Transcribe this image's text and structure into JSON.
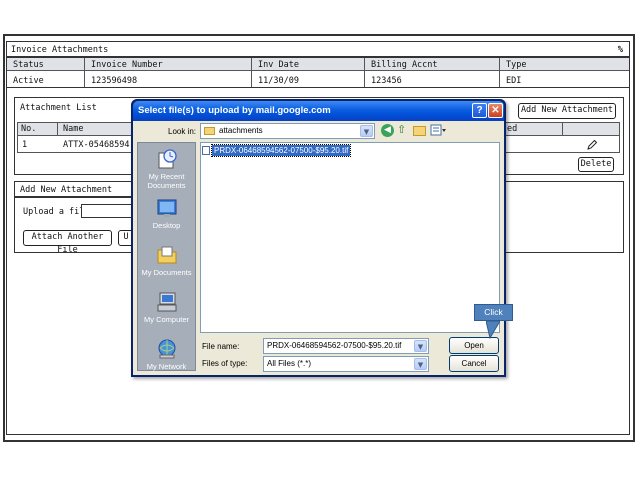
{
  "mockup": {
    "title": "Invoice Attachments",
    "title_badge": "%",
    "summary_headers": [
      "Status",
      "Invoice Number",
      "Inv Date",
      "Billing Accnt",
      "Type"
    ],
    "summary_values": [
      "Active",
      "123596498",
      "11/30/09",
      "123456",
      "EDI"
    ],
    "attachment_list": {
      "label": "Attachment List",
      "add_button": "Add New Attachment",
      "columns": [
        "No.",
        "Name",
        "ed"
      ],
      "rows": [
        {
          "no": "1",
          "name": "ATTX-05468594"
        }
      ],
      "delete_button": "Delete"
    },
    "add_new": {
      "label": "Add New Attachment",
      "upload_label": "Upload a file:",
      "attach_another_button": "Attach Another File",
      "upload_button_partial": "U"
    }
  },
  "dialog": {
    "title": "Select file(s) to upload by mail.google.com",
    "help": "?",
    "close": "✕",
    "look_in_label": "Look in:",
    "look_in_value": "attachments",
    "places": [
      "My Recent Documents",
      "Desktop",
      "My Documents",
      "My Computer",
      "My Network"
    ],
    "files": [
      "PRDX-06468594562-07500-$95.20.tif"
    ],
    "file_name_label": "File name:",
    "file_name_value": "PRDX-06468594562-07500-$95.20.tif",
    "file_type_label": "Files of type:",
    "file_type_value": "All Files (*.*)",
    "open_button": "Open",
    "cancel_button": "Cancel"
  },
  "callout": {
    "text": "Click"
  },
  "colors": {
    "xp_title": "#0a5ddf",
    "xp_face": "#ece9d8",
    "callout": "#4f81bd",
    "places_bar": "#a6aeb9"
  }
}
